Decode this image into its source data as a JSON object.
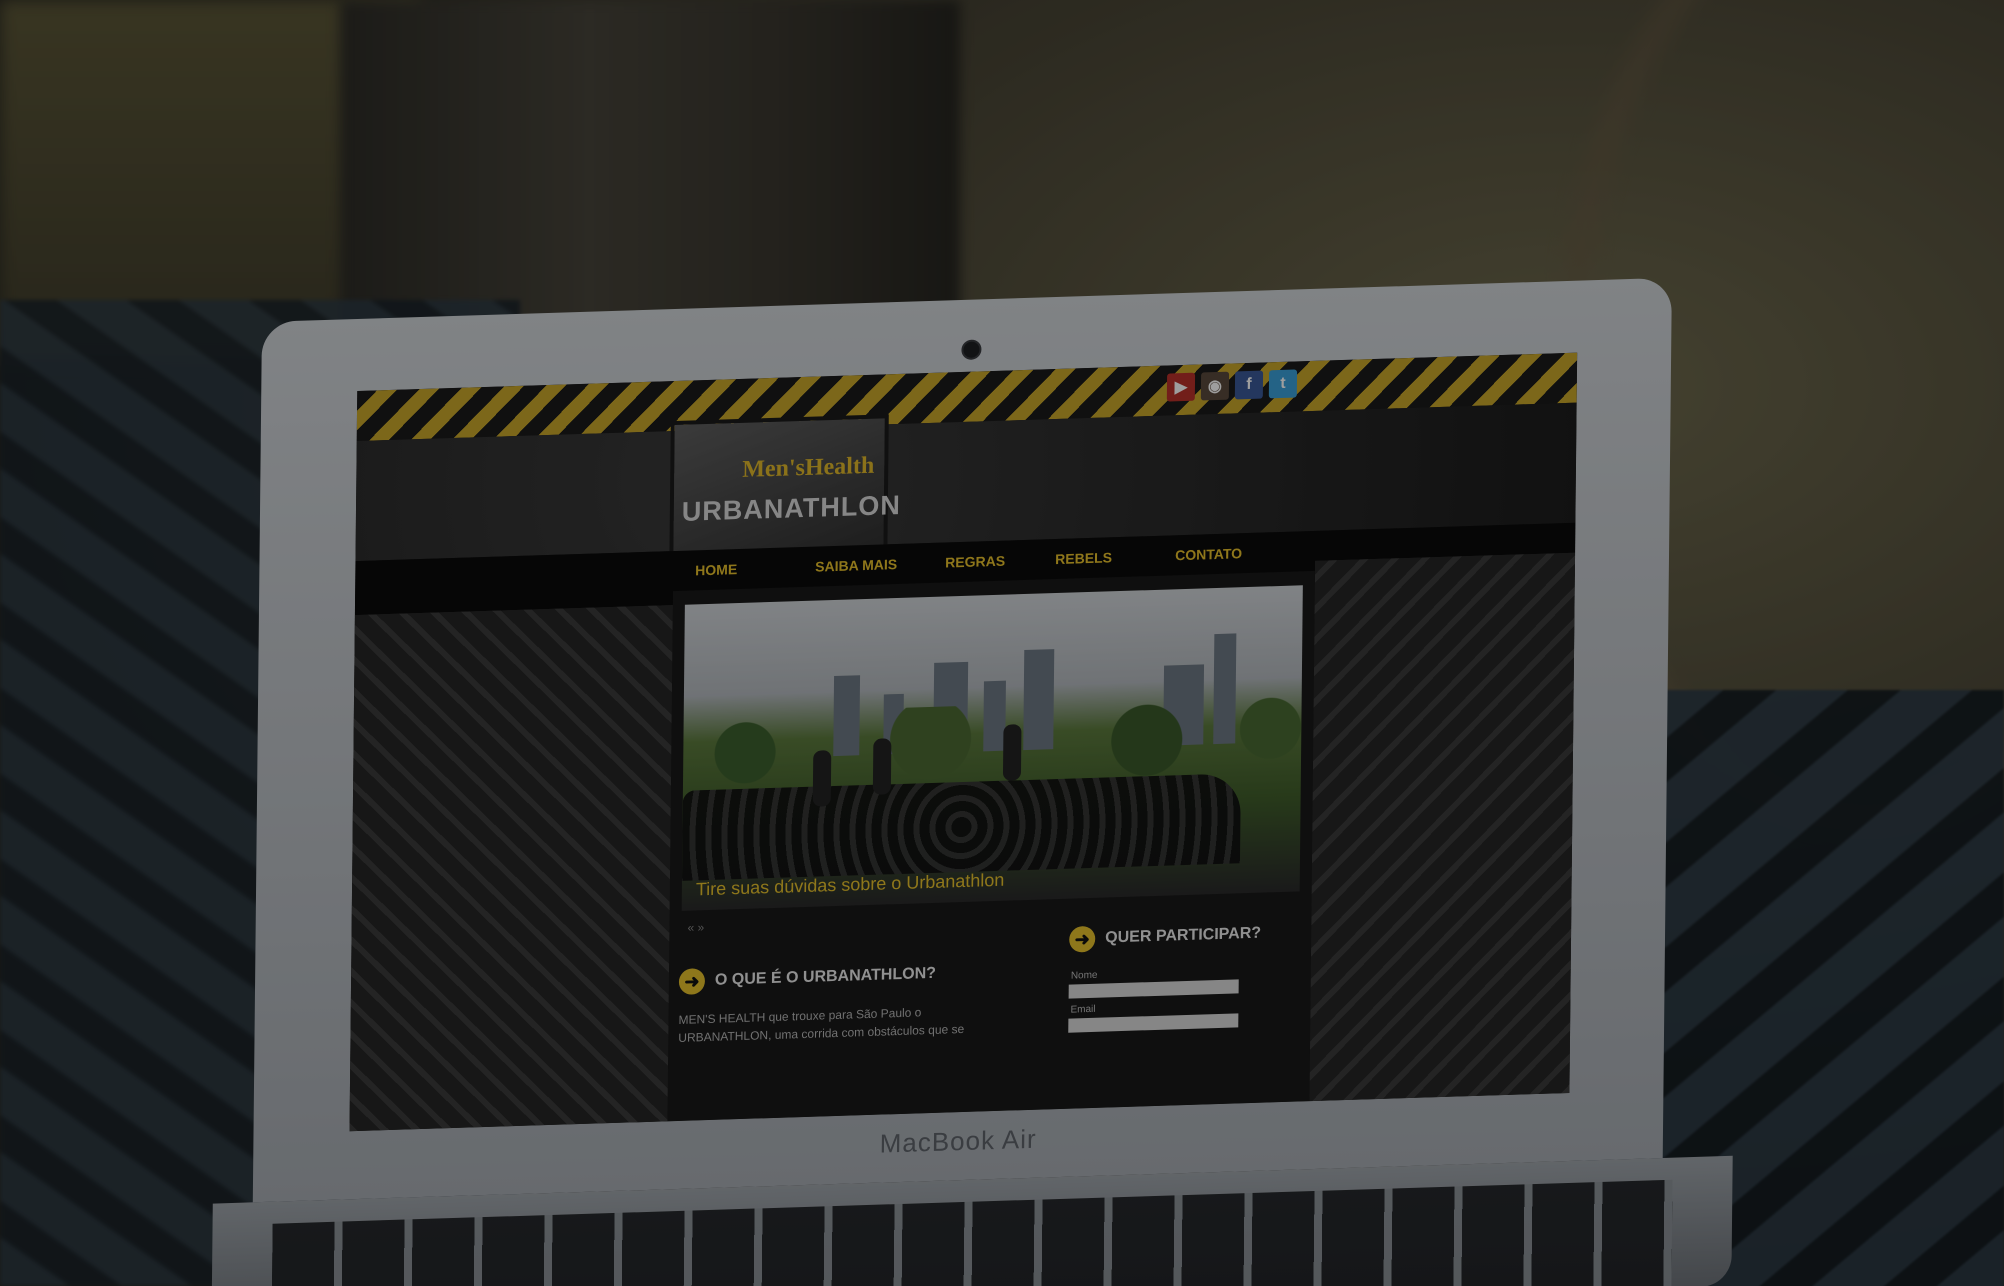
{
  "device": {
    "brand_label": "MacBook Air"
  },
  "site": {
    "logo": {
      "top_text": "Men'sHealth",
      "main_text": "URBANATHLON"
    },
    "social_icons": [
      "youtube-icon",
      "instagram-icon",
      "facebook-icon",
      "twitter-icon"
    ],
    "nav": [
      "Home",
      "Saiba Mais",
      "Regras",
      "Rebels",
      "Contato"
    ],
    "hero_caption": "Tire suas dúvidas sobre o Urbanathlon",
    "pager_text": "« »",
    "section_about": {
      "title": "O que é o Urbanathlon?",
      "text": "MEN'S HEALTH que trouxe para São Paulo o URBANATHLON, uma corrida com obstáculos que se"
    },
    "section_join": {
      "title": "Quer participar?",
      "field_label_1": "Nome",
      "field_label_2": "Email"
    },
    "colors": {
      "accent": "#e6c02c",
      "background": "#151515"
    }
  }
}
